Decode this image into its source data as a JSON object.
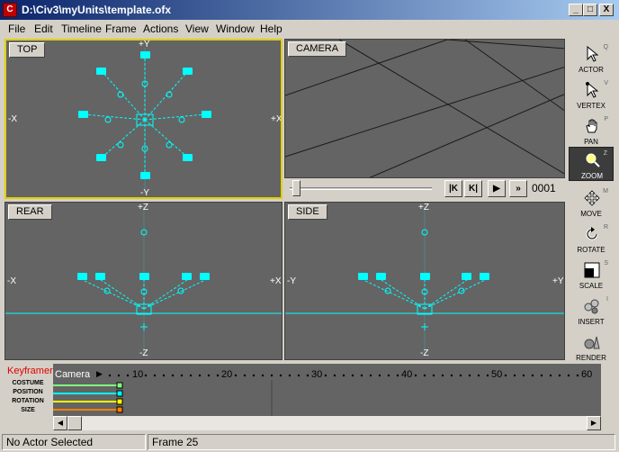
{
  "window": {
    "title": "D:\\Civ3\\myUnits\\template.ofx",
    "minimize": "_",
    "maximize": "□",
    "close": "X"
  },
  "menu": [
    "File",
    "Edit",
    "Timeline",
    "Frame",
    "Actions",
    "View",
    "Window",
    "Help"
  ],
  "viewports": {
    "top": {
      "label": "TOP",
      "pos_y": "+Y",
      "neg_y": "-Y",
      "neg_x": "-X",
      "pos_x": "+X"
    },
    "camera": {
      "label": "CAMERA"
    },
    "rear": {
      "label": "REAR",
      "pos_z": "+Z",
      "neg_z": "-Z",
      "neg_x": "-X",
      "pos_x": "+X"
    },
    "side": {
      "label": "SIDE",
      "pos_z": "+Z",
      "neg_z": "-Z",
      "neg_y": "-Y",
      "pos_y": "+Y"
    }
  },
  "playback": {
    "frame_counter": "0001",
    "btn_first": "|K",
    "btn_prev": "K|",
    "btn_play": "▶",
    "btn_last": "»"
  },
  "tools": [
    {
      "label": "ACTOR",
      "hotkey": "Q",
      "icon": "arrow-icon"
    },
    {
      "label": "VERTEX",
      "hotkey": "V",
      "icon": "vertex-arrow-icon"
    },
    {
      "label": "PAN",
      "hotkey": "P",
      "icon": "hand-icon"
    },
    {
      "label": "ZOOM",
      "hotkey": "Z",
      "icon": "magnifier-icon"
    },
    {
      "label": "MOVE",
      "hotkey": "M",
      "icon": "move-arrows-icon"
    },
    {
      "label": "ROTATE",
      "hotkey": "R",
      "icon": "rotate-icon"
    },
    {
      "label": "SCALE",
      "hotkey": "S",
      "icon": "scale-icon"
    },
    {
      "label": "INSERT",
      "hotkey": "I",
      "icon": "insert-icon"
    },
    {
      "label": "RENDER",
      "hotkey": "",
      "icon": "render-icon"
    }
  ],
  "keyframer": {
    "title": "Keyframer",
    "rows": [
      "COSTUME",
      "POSITION",
      "ROTATION",
      "SIZE"
    ],
    "track_name": "Camera",
    "ticks": [
      "10",
      "20",
      "30",
      "40",
      "50",
      "60"
    ]
  },
  "status": {
    "left": "No Actor Selected",
    "right": "Frame 25"
  }
}
